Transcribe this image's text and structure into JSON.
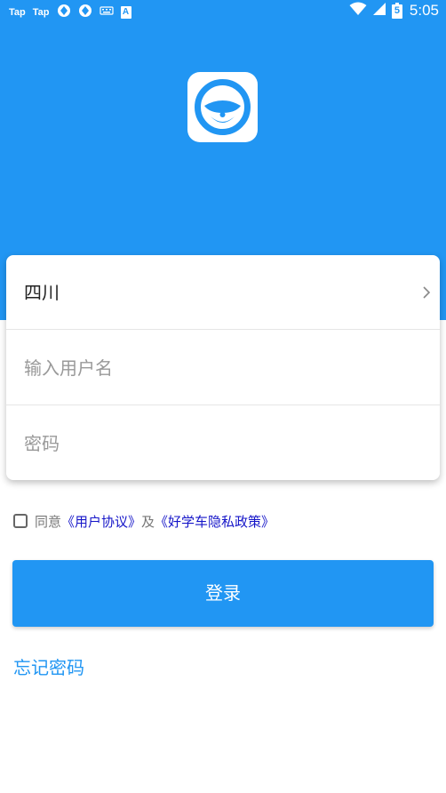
{
  "status_bar": {
    "left_labels": [
      "Tap",
      "Tap"
    ],
    "extra_label": "A",
    "time": "5:05",
    "battery_level": "5"
  },
  "app": {
    "logo_icon": "steering-wheel-icon",
    "brand_color": "#2196f3"
  },
  "form": {
    "region": {
      "value": "四川",
      "icon": "chevron-right-icon"
    },
    "username": {
      "placeholder": "输入用户名",
      "value": ""
    },
    "password": {
      "placeholder": "密码",
      "value": ""
    }
  },
  "agreement": {
    "checked": false,
    "prefix": "同意",
    "user_agreement": "《用户协议》",
    "and": "及",
    "privacy_policy": "《好学车隐私政策》",
    "link_color": "#1515c8"
  },
  "actions": {
    "login_label": "登录",
    "forgot_label": "忘记密码"
  }
}
